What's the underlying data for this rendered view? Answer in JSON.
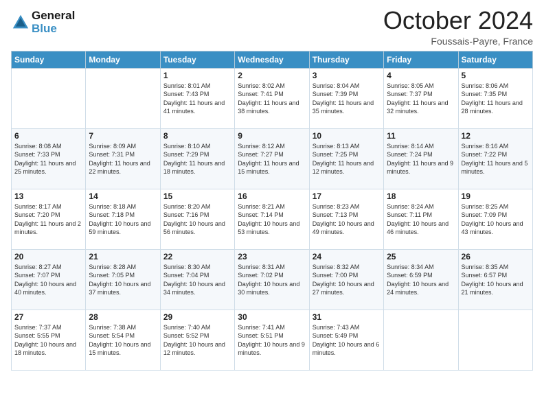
{
  "header": {
    "logo_line1": "General",
    "logo_line2": "Blue",
    "month_title": "October 2024",
    "subtitle": "Foussais-Payre, France"
  },
  "weekdays": [
    "Sunday",
    "Monday",
    "Tuesday",
    "Wednesday",
    "Thursday",
    "Friday",
    "Saturday"
  ],
  "weeks": [
    [
      {
        "day": "",
        "sunrise": "",
        "sunset": "",
        "daylight": ""
      },
      {
        "day": "",
        "sunrise": "",
        "sunset": "",
        "daylight": ""
      },
      {
        "day": "1",
        "sunrise": "Sunrise: 8:01 AM",
        "sunset": "Sunset: 7:43 PM",
        "daylight": "Daylight: 11 hours and 41 minutes."
      },
      {
        "day": "2",
        "sunrise": "Sunrise: 8:02 AM",
        "sunset": "Sunset: 7:41 PM",
        "daylight": "Daylight: 11 hours and 38 minutes."
      },
      {
        "day": "3",
        "sunrise": "Sunrise: 8:04 AM",
        "sunset": "Sunset: 7:39 PM",
        "daylight": "Daylight: 11 hours and 35 minutes."
      },
      {
        "day": "4",
        "sunrise": "Sunrise: 8:05 AM",
        "sunset": "Sunset: 7:37 PM",
        "daylight": "Daylight: 11 hours and 32 minutes."
      },
      {
        "day": "5",
        "sunrise": "Sunrise: 8:06 AM",
        "sunset": "Sunset: 7:35 PM",
        "daylight": "Daylight: 11 hours and 28 minutes."
      }
    ],
    [
      {
        "day": "6",
        "sunrise": "Sunrise: 8:08 AM",
        "sunset": "Sunset: 7:33 PM",
        "daylight": "Daylight: 11 hours and 25 minutes."
      },
      {
        "day": "7",
        "sunrise": "Sunrise: 8:09 AM",
        "sunset": "Sunset: 7:31 PM",
        "daylight": "Daylight: 11 hours and 22 minutes."
      },
      {
        "day": "8",
        "sunrise": "Sunrise: 8:10 AM",
        "sunset": "Sunset: 7:29 PM",
        "daylight": "Daylight: 11 hours and 18 minutes."
      },
      {
        "day": "9",
        "sunrise": "Sunrise: 8:12 AM",
        "sunset": "Sunset: 7:27 PM",
        "daylight": "Daylight: 11 hours and 15 minutes."
      },
      {
        "day": "10",
        "sunrise": "Sunrise: 8:13 AM",
        "sunset": "Sunset: 7:25 PM",
        "daylight": "Daylight: 11 hours and 12 minutes."
      },
      {
        "day": "11",
        "sunrise": "Sunrise: 8:14 AM",
        "sunset": "Sunset: 7:24 PM",
        "daylight": "Daylight: 11 hours and 9 minutes."
      },
      {
        "day": "12",
        "sunrise": "Sunrise: 8:16 AM",
        "sunset": "Sunset: 7:22 PM",
        "daylight": "Daylight: 11 hours and 5 minutes."
      }
    ],
    [
      {
        "day": "13",
        "sunrise": "Sunrise: 8:17 AM",
        "sunset": "Sunset: 7:20 PM",
        "daylight": "Daylight: 11 hours and 2 minutes."
      },
      {
        "day": "14",
        "sunrise": "Sunrise: 8:18 AM",
        "sunset": "Sunset: 7:18 PM",
        "daylight": "Daylight: 10 hours and 59 minutes."
      },
      {
        "day": "15",
        "sunrise": "Sunrise: 8:20 AM",
        "sunset": "Sunset: 7:16 PM",
        "daylight": "Daylight: 10 hours and 56 minutes."
      },
      {
        "day": "16",
        "sunrise": "Sunrise: 8:21 AM",
        "sunset": "Sunset: 7:14 PM",
        "daylight": "Daylight: 10 hours and 53 minutes."
      },
      {
        "day": "17",
        "sunrise": "Sunrise: 8:23 AM",
        "sunset": "Sunset: 7:13 PM",
        "daylight": "Daylight: 10 hours and 49 minutes."
      },
      {
        "day": "18",
        "sunrise": "Sunrise: 8:24 AM",
        "sunset": "Sunset: 7:11 PM",
        "daylight": "Daylight: 10 hours and 46 minutes."
      },
      {
        "day": "19",
        "sunrise": "Sunrise: 8:25 AM",
        "sunset": "Sunset: 7:09 PM",
        "daylight": "Daylight: 10 hours and 43 minutes."
      }
    ],
    [
      {
        "day": "20",
        "sunrise": "Sunrise: 8:27 AM",
        "sunset": "Sunset: 7:07 PM",
        "daylight": "Daylight: 10 hours and 40 minutes."
      },
      {
        "day": "21",
        "sunrise": "Sunrise: 8:28 AM",
        "sunset": "Sunset: 7:05 PM",
        "daylight": "Daylight: 10 hours and 37 minutes."
      },
      {
        "day": "22",
        "sunrise": "Sunrise: 8:30 AM",
        "sunset": "Sunset: 7:04 PM",
        "daylight": "Daylight: 10 hours and 34 minutes."
      },
      {
        "day": "23",
        "sunrise": "Sunrise: 8:31 AM",
        "sunset": "Sunset: 7:02 PM",
        "daylight": "Daylight: 10 hours and 30 minutes."
      },
      {
        "day": "24",
        "sunrise": "Sunrise: 8:32 AM",
        "sunset": "Sunset: 7:00 PM",
        "daylight": "Daylight: 10 hours and 27 minutes."
      },
      {
        "day": "25",
        "sunrise": "Sunrise: 8:34 AM",
        "sunset": "Sunset: 6:59 PM",
        "daylight": "Daylight: 10 hours and 24 minutes."
      },
      {
        "day": "26",
        "sunrise": "Sunrise: 8:35 AM",
        "sunset": "Sunset: 6:57 PM",
        "daylight": "Daylight: 10 hours and 21 minutes."
      }
    ],
    [
      {
        "day": "27",
        "sunrise": "Sunrise: 7:37 AM",
        "sunset": "Sunset: 5:55 PM",
        "daylight": "Daylight: 10 hours and 18 minutes."
      },
      {
        "day": "28",
        "sunrise": "Sunrise: 7:38 AM",
        "sunset": "Sunset: 5:54 PM",
        "daylight": "Daylight: 10 hours and 15 minutes."
      },
      {
        "day": "29",
        "sunrise": "Sunrise: 7:40 AM",
        "sunset": "Sunset: 5:52 PM",
        "daylight": "Daylight: 10 hours and 12 minutes."
      },
      {
        "day": "30",
        "sunrise": "Sunrise: 7:41 AM",
        "sunset": "Sunset: 5:51 PM",
        "daylight": "Daylight: 10 hours and 9 minutes."
      },
      {
        "day": "31",
        "sunrise": "Sunrise: 7:43 AM",
        "sunset": "Sunset: 5:49 PM",
        "daylight": "Daylight: 10 hours and 6 minutes."
      },
      {
        "day": "",
        "sunrise": "",
        "sunset": "",
        "daylight": ""
      },
      {
        "day": "",
        "sunrise": "",
        "sunset": "",
        "daylight": ""
      }
    ]
  ]
}
